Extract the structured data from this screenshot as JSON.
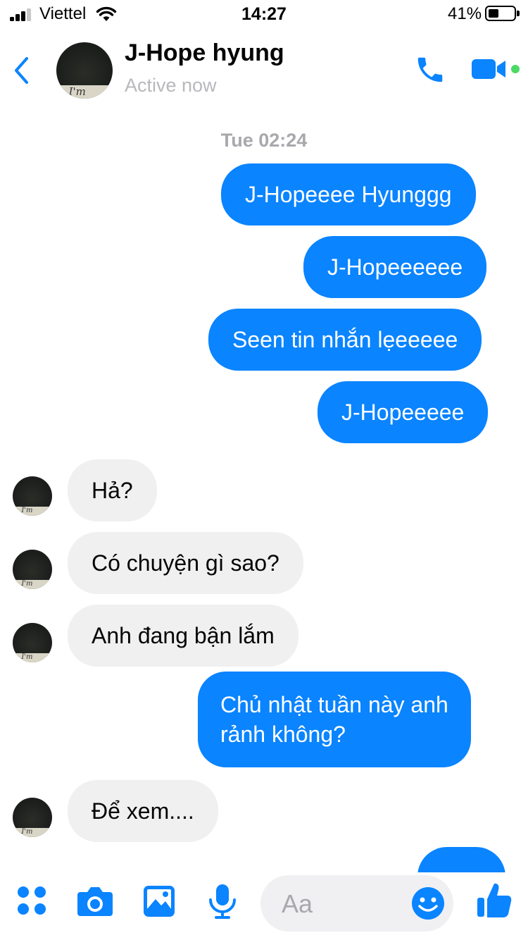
{
  "status_bar": {
    "carrier": "Viettel",
    "time": "14:27",
    "battery_percent": "41%",
    "battery_level": 0.41
  },
  "header": {
    "contact_name": "J-Hope hyung",
    "presence": "Active now",
    "avatar_caption": "I'm",
    "icons": {
      "back": "chevron-left-icon",
      "call": "phone-icon",
      "video": "video-camera-icon"
    },
    "accent_color": "#0a84ff",
    "online_color": "#4cd964"
  },
  "conversation": {
    "timestamp": "Tue 02:24",
    "messages": [
      {
        "sender": "me",
        "text": "J-Hopeeee Hyunggg"
      },
      {
        "sender": "me",
        "text": "J-Hopeeeeee"
      },
      {
        "sender": "me",
        "text": "Seen tin nhắn lẹeeeee"
      },
      {
        "sender": "me",
        "text": "J-Hopeeeee"
      },
      {
        "sender": "them",
        "text": "Hả?"
      },
      {
        "sender": "them",
        "text": "Có chuyện gì sao?"
      },
      {
        "sender": "them",
        "text": "Anh đang bận lắm"
      },
      {
        "sender": "me",
        "text_lines": [
          "Chủ nhật tuần này anh",
          "rảnh không?"
        ]
      },
      {
        "sender": "them",
        "text": "Để xem...."
      },
      {
        "sender": "me",
        "text": ""
      }
    ],
    "outgoing_color": "#0a84ff",
    "incoming_color": "#f0f0f0"
  },
  "composer": {
    "placeholder": "Aa",
    "icons": [
      "apps-menu-icon",
      "camera-icon",
      "photo-gallery-icon",
      "microphone-icon",
      "emoji-icon",
      "thumbs-up-icon"
    ]
  }
}
